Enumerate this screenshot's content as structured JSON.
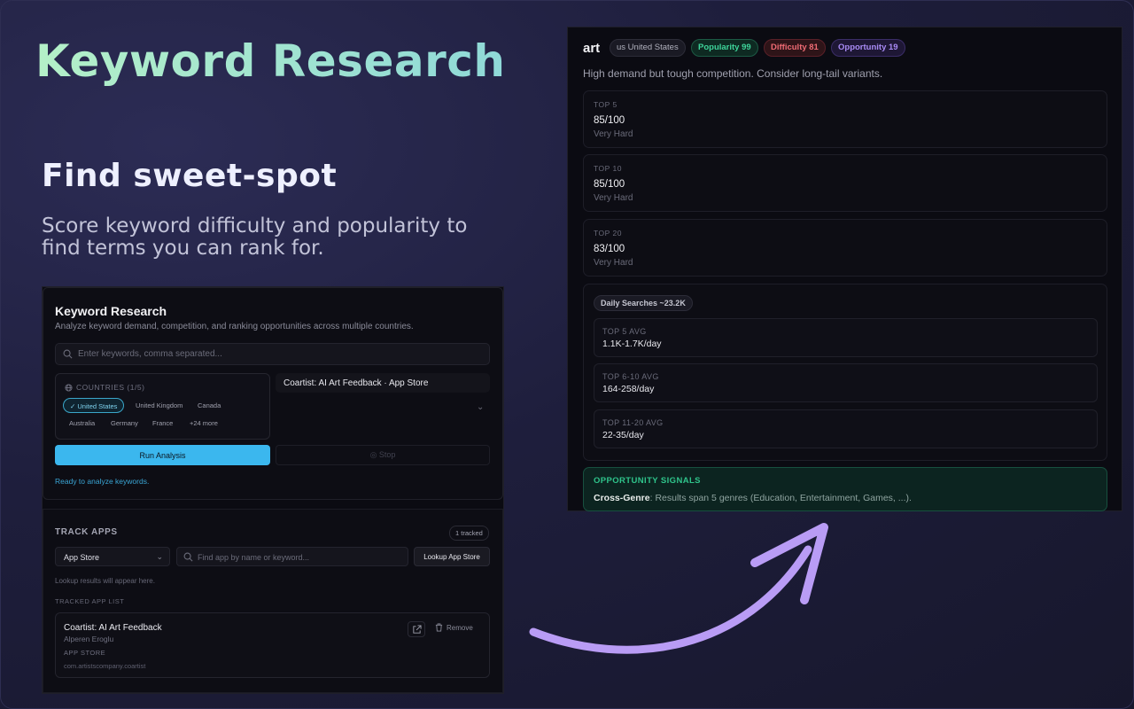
{
  "hero": {
    "title": "Keyword Research",
    "subtitle": "Find sweet-spot",
    "description": "Score keyword difficulty and popularity to find terms you can rank for."
  },
  "left_panel": {
    "title": "Keyword Research",
    "subtitle": "Analyze keyword demand, competition, and ranking opportunities across multiple countries.",
    "search_placeholder": "Enter keywords, comma separated...",
    "countries": {
      "label": "COUNTRIES (1/5)",
      "chips": [
        "United States",
        "United Kingdom",
        "Canada",
        "Australia",
        "Germany",
        "France",
        "+24 more"
      ],
      "selected": "United States"
    },
    "selected_app": "Coartist: AI Art Feedback · App Store",
    "run_label": "Run Analysis",
    "stop_label": "Stop",
    "status": "Ready to analyze keywords.",
    "track": {
      "title": "TRACK APPS",
      "badge": "1 tracked",
      "store": "App Store",
      "find_placeholder": "Find app by name or keyword...",
      "lookup_label": "Lookup App Store",
      "lookup_note": "Lookup results will appear here.",
      "list_header": "TRACKED APP LIST",
      "app": {
        "name": "Coartist: AI Art Feedback",
        "developer": "Alperen Eroglu",
        "store": "APP STORE",
        "bundle": "com.artistscompany.coartist",
        "remove_label": "Remove"
      }
    }
  },
  "right_panel": {
    "keyword": "art",
    "country_badge": "us United States",
    "popularity_badge": "Popularity 99",
    "difficulty_badge": "Difficulty 81",
    "opportunity_badge": "Opportunity 19",
    "hint": "High demand but tough competition. Consider long-tail variants.",
    "tiers": [
      {
        "label": "TOP 5",
        "value": "85/100",
        "desc": "Very Hard"
      },
      {
        "label": "TOP 10",
        "value": "85/100",
        "desc": "Very Hard"
      },
      {
        "label": "TOP 20",
        "value": "83/100",
        "desc": "Very Hard"
      }
    ],
    "daily_badge": "Daily Searches ~23.2K",
    "avgs": [
      {
        "label": "TOP 5 AVG",
        "value": "1.1K-1.7K/day"
      },
      {
        "label": "TOP 6-10 AVG",
        "value": "164-258/day"
      },
      {
        "label": "TOP 11-20 AVG",
        "value": "22-35/day"
      }
    ],
    "signals": {
      "title": "OPPORTUNITY SIGNALS",
      "label": "Cross-Genre",
      "text": ": Results span 5 genres (Education, Entertainment, Games, ...)."
    }
  },
  "colors": {
    "accent": "#3bb7ee",
    "popularity": "#3ed49a",
    "difficulty": "#ef6b74",
    "opportunity": "#a98bf5",
    "arrow": "#b99cf5"
  }
}
